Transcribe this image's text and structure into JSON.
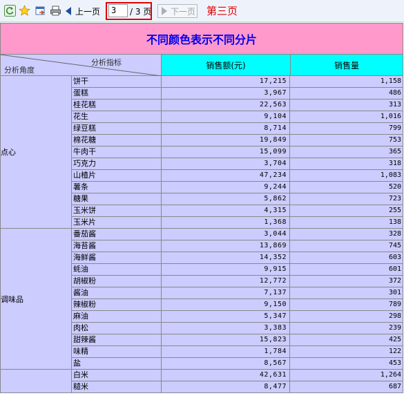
{
  "toolbar": {
    "prev_label": "上一页",
    "next_label": "下一页",
    "current_page": "3",
    "total_pages": "/ 3 页",
    "page_title": "第三页"
  },
  "report": {
    "title": "不同颜色表示不同分片",
    "header_metric": "分析指标",
    "header_angle": "分析角度",
    "col_sales_amount": "销售额(元)",
    "col_sales_qty": "销售量"
  },
  "groups": [
    {
      "name": "点心",
      "rows": [
        {
          "item": "饼干",
          "amount": "17,215",
          "qty": "1,158"
        },
        {
          "item": "蛋糕",
          "amount": "3,967",
          "qty": "486"
        },
        {
          "item": "桂花糕",
          "amount": "22,563",
          "qty": "313"
        },
        {
          "item": "花生",
          "amount": "9,104",
          "qty": "1,016"
        },
        {
          "item": "绿豆糕",
          "amount": "8,714",
          "qty": "799"
        },
        {
          "item": "棉花糖",
          "amount": "19,849",
          "qty": "753"
        },
        {
          "item": "牛肉干",
          "amount": "15,099",
          "qty": "365"
        },
        {
          "item": "巧克力",
          "amount": "3,704",
          "qty": "318"
        },
        {
          "item": "山楂片",
          "amount": "47,234",
          "qty": "1,083"
        },
        {
          "item": "薯条",
          "amount": "9,244",
          "qty": "520"
        },
        {
          "item": "糖果",
          "amount": "5,862",
          "qty": "723"
        },
        {
          "item": "玉米饼",
          "amount": "4,315",
          "qty": "255"
        },
        {
          "item": "玉米片",
          "amount": "1,368",
          "qty": "138"
        }
      ]
    },
    {
      "name": "调味品",
      "rows": [
        {
          "item": "番茄酱",
          "amount": "3,044",
          "qty": "328"
        },
        {
          "item": "海苔酱",
          "amount": "13,869",
          "qty": "745"
        },
        {
          "item": "海鲜酱",
          "amount": "14,352",
          "qty": "603"
        },
        {
          "item": "蚝油",
          "amount": "9,915",
          "qty": "601"
        },
        {
          "item": "胡椒粉",
          "amount": "12,772",
          "qty": "372"
        },
        {
          "item": "酱油",
          "amount": "7,137",
          "qty": "301"
        },
        {
          "item": "辣椒粉",
          "amount": "9,150",
          "qty": "789"
        },
        {
          "item": "麻油",
          "amount": "5,347",
          "qty": "298"
        },
        {
          "item": "肉松",
          "amount": "3,383",
          "qty": "239"
        },
        {
          "item": "甜辣酱",
          "amount": "15,823",
          "qty": "425"
        },
        {
          "item": "味精",
          "amount": "1,784",
          "qty": "122"
        },
        {
          "item": "盐",
          "amount": "8,567",
          "qty": "453"
        }
      ]
    },
    {
      "name": "",
      "rows": [
        {
          "item": "白米",
          "amount": "42,631",
          "qty": "1,264"
        },
        {
          "item": "糙米",
          "amount": "8,477",
          "qty": "687"
        }
      ]
    }
  ]
}
